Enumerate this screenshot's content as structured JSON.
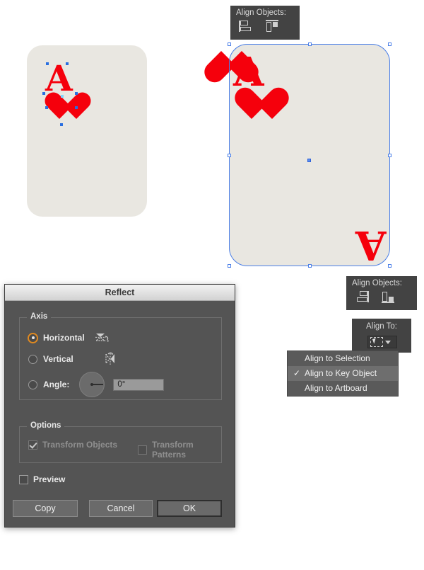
{
  "canvas": {
    "card_color": "#e9e7e1",
    "suit_color": "#f5000c",
    "selection_color": "#4a7fe8",
    "cards": [
      {
        "name": "unselected-card",
        "rank": "A",
        "suit": "heart",
        "selected": false
      },
      {
        "name": "selected-card",
        "rank": "A",
        "suit": "heart",
        "selected": true
      }
    ]
  },
  "align_panel_top": {
    "label": "Align Objects:",
    "buttons": [
      {
        "name": "horizontal-align-left",
        "icon": "align-left-icon"
      },
      {
        "name": "vertical-align-top",
        "icon": "align-top-icon"
      }
    ]
  },
  "align_panel_bottom": {
    "label": "Align Objects:",
    "buttons": [
      {
        "name": "horizontal-align-right",
        "icon": "align-right-icon"
      },
      {
        "name": "vertical-align-bottom",
        "icon": "align-bottom-icon"
      }
    ]
  },
  "align_to": {
    "label": "Align To:",
    "button_icon": "key-object-icon",
    "dropdown_icon": "chevron-down-icon"
  },
  "align_menu": {
    "items": [
      {
        "label": "Align to Selection",
        "checked": false,
        "highlighted": false
      },
      {
        "label": "Align to Key Object",
        "checked": true,
        "highlighted": true
      },
      {
        "label": "Align to Artboard",
        "checked": false,
        "highlighted": false
      }
    ],
    "check_glyph": "✓"
  },
  "reflect_dialog": {
    "title": "Reflect",
    "axis": {
      "group_label": "Axis",
      "horizontal": {
        "label": "Horizontal",
        "selected": true,
        "icon": "flip-horizontal-icon"
      },
      "vertical": {
        "label": "Vertical",
        "selected": false,
        "icon": "flip-vertical-icon"
      },
      "angle": {
        "label": "Angle:",
        "selected": false,
        "value": "0°",
        "dial_icon": "angle-dial-icon"
      }
    },
    "options": {
      "group_label": "Options",
      "transform_objects": {
        "label": "Transform Objects",
        "checked": true,
        "enabled": false
      },
      "transform_patterns": {
        "label": "Transform Patterns",
        "checked": false,
        "enabled": false
      }
    },
    "preview": {
      "label": "Preview",
      "checked": false
    },
    "buttons": {
      "copy": "Copy",
      "cancel": "Cancel",
      "ok": "OK"
    }
  }
}
